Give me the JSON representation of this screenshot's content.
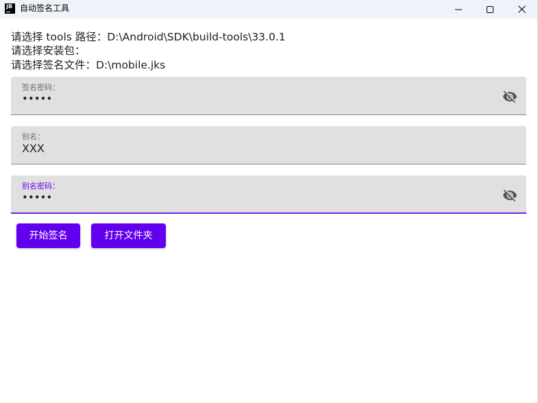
{
  "window": {
    "title": "自动签名工具",
    "app_icon_text": "JB",
    "controls": {
      "minimize": "minimize-icon",
      "maximize": "maximize-icon",
      "close": "close-icon"
    }
  },
  "info": {
    "tools_path": "请选择 tools 路径：D:\\Android\\SDK\\build-tools\\33.0.1",
    "apk": "请选择安装包：",
    "sign_file": "请选择签名文件：D:\\mobile.jks"
  },
  "fields": {
    "sign_password": {
      "label": "签名密码：",
      "value": "•••••",
      "icon": "eye-off-icon"
    },
    "alias": {
      "label": "别名：",
      "value": "XXX"
    },
    "alias_password": {
      "label": "别名密码：",
      "value": "•••••",
      "icon": "eye-off-icon",
      "focused": true
    }
  },
  "buttons": {
    "start_sign": "开始签名",
    "open_folder": "打开文件夹"
  },
  "colors": {
    "accent": "#6200ee",
    "focus_label": "#6a00ee",
    "field_bg": "#e0e0e0",
    "titlebar_bg": "#eef3f9"
  }
}
